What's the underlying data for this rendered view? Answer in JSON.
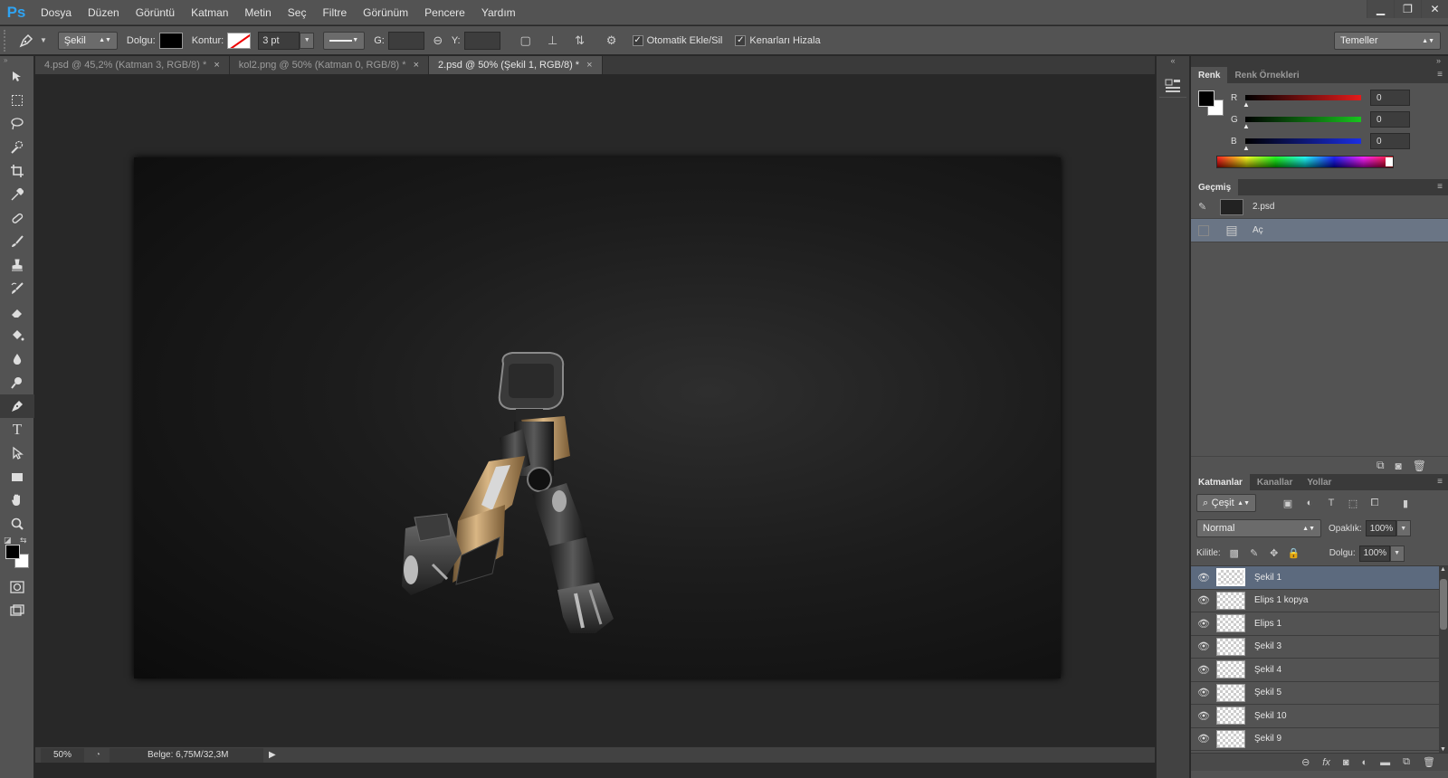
{
  "app": {
    "logo": "Ps"
  },
  "menu": [
    "Dosya",
    "Düzen",
    "Görüntü",
    "Katman",
    "Metin",
    "Seç",
    "Filtre",
    "Görünüm",
    "Pencere",
    "Yardım"
  ],
  "window_controls": {
    "minimize": "▁",
    "restore": "❐",
    "close": "✕"
  },
  "options": {
    "tool_mode": "Şekil",
    "fill_label": "Dolgu:",
    "stroke_label": "Kontur:",
    "stroke_width": "3 pt",
    "w_label": "G:",
    "h_label": "Y:",
    "auto_add_delete": "Otomatik Ekle/Sil",
    "align_edges": "Kenarları Hizala",
    "workspace": "Temeller"
  },
  "tabs": [
    {
      "label": "4.psd @ 45,2% (Katman 3, RGB/8) *",
      "close": "×"
    },
    {
      "label": "kol2.png @ 50% (Katman 0, RGB/8) *",
      "close": "×"
    },
    {
      "label": "2.psd @ 50% (Şekil 1, RGB/8) *",
      "close": "×"
    }
  ],
  "status": {
    "zoom": "50%",
    "doc_info": "Belge: 6,75M/32,3M"
  },
  "color_panel": {
    "tabs": [
      "Renk",
      "Renk Örnekleri"
    ],
    "r_label": "R",
    "r_value": "0",
    "g_label": "G",
    "g_value": "0",
    "b_label": "B",
    "b_value": "0",
    "colors": {
      "r": "#e31b1b",
      "g": "#18c41e",
      "b": "#1b2ee3"
    }
  },
  "history_panel": {
    "tab": "Geçmiş",
    "snapshot": "2.psd",
    "step": "Aç"
  },
  "layers_panel": {
    "tabs": [
      "Katmanlar",
      "Kanallar",
      "Yollar"
    ],
    "filter": "Çeşit",
    "blend_mode": "Normal",
    "opacity_label": "Opaklık:",
    "opacity": "100%",
    "lock_label": "Kilitle:",
    "fill_label": "Dolgu:",
    "fill": "100%",
    "layers": [
      {
        "name": "Şekil 1",
        "selected": true
      },
      {
        "name": "Elips 1 kopya",
        "selected": false
      },
      {
        "name": "Elips 1",
        "selected": false
      },
      {
        "name": "Şekil 3",
        "selected": false
      },
      {
        "name": "Şekil 4",
        "selected": false
      },
      {
        "name": "Şekil 5",
        "selected": false
      },
      {
        "name": "Şekil 10",
        "selected": false
      },
      {
        "name": "Şekil 9",
        "selected": false
      }
    ]
  },
  "icons": {
    "pen": "pen-icon",
    "move": "move-icon",
    "marquee": "marquee-icon",
    "lasso": "lasso-icon",
    "quick_select": "quick-select-icon",
    "crop": "crop-icon",
    "eyedropper": "eyedropper-icon",
    "healing": "healing-icon",
    "brush": "brush-icon",
    "stamp": "stamp-icon",
    "history_brush": "history-brush-icon",
    "eraser": "eraser-icon",
    "bucket": "bucket-icon",
    "blur": "blur-icon",
    "dodge": "dodge-icon",
    "type": "type-icon",
    "path_select": "path-select-icon",
    "rectangle": "rectangle-icon",
    "hand": "hand-icon",
    "zoom": "zoom-icon",
    "quick_mask": "quick-mask-icon",
    "screen_mode": "screen-mode-icon"
  }
}
